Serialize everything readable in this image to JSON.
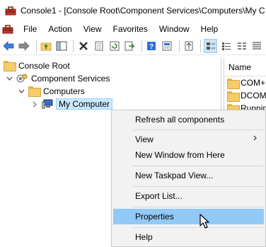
{
  "window": {
    "title": "Console1 - [Console Root\\Component Services\\Computers\\My C",
    "app_icon": "mmc-toolbox-icon"
  },
  "menubar": {
    "items": [
      "File",
      "Action",
      "View",
      "Favorites",
      "Window",
      "Help"
    ]
  },
  "toolbar": {
    "buttons": [
      "back-arrow-icon",
      "forward-arrow-icon",
      "up-folder-icon",
      "show-hide-tree-icon",
      "delete-icon",
      "properties-icon",
      "refresh-icon",
      "export-list-icon",
      "help-icon",
      "help-topics-icon",
      "new-window-icon",
      "large-icons-view-icon",
      "small-icons-view-icon",
      "list-view-icon",
      "detail-view-icon"
    ]
  },
  "tree": {
    "items": [
      {
        "label": "Console Root",
        "icon": "folder-icon"
      },
      {
        "label": "Component Services",
        "icon": "component-services-icon",
        "expanded": true
      },
      {
        "label": "Computers",
        "icon": "folder-icon",
        "expanded": true
      },
      {
        "label": "My Computer",
        "icon": "computer-icon",
        "selected": true
      }
    ]
  },
  "list": {
    "header": "Name",
    "rows": [
      "COM+",
      "DCOM",
      "Running"
    ]
  },
  "context_menu": {
    "items": [
      {
        "label": "Refresh all components"
      },
      {
        "label": "View",
        "submenu": true
      },
      {
        "label": "New Window from Here"
      },
      {
        "label": "New Taskpad View..."
      },
      {
        "label": "Export List..."
      },
      {
        "label": "Properties",
        "highlighted": true
      },
      {
        "label": "Help"
      }
    ]
  },
  "colors": {
    "highlight": "#91c9f7",
    "menu_bg": "#f2f2f2",
    "folder": "#f5cc6a"
  }
}
